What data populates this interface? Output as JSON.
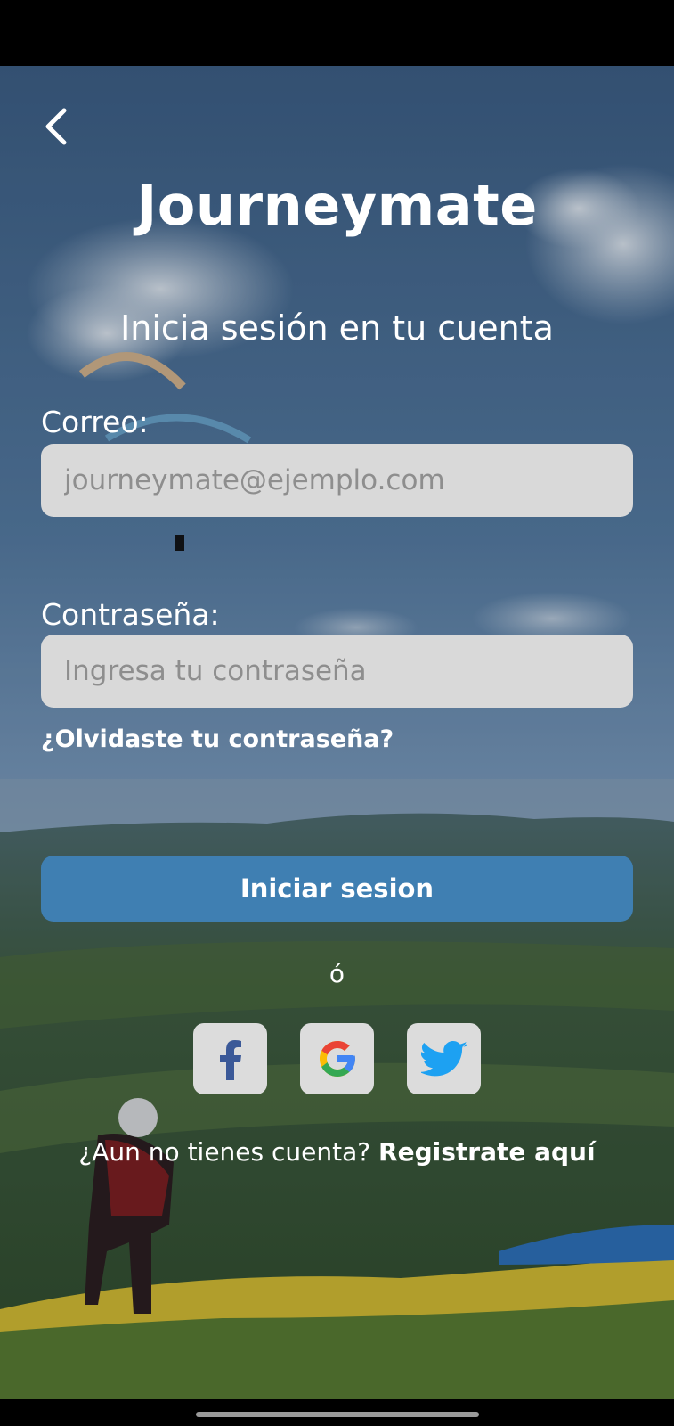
{
  "app": {
    "title": "Journeymate"
  },
  "login": {
    "subtitle": "Inicia sesión en tu cuenta",
    "email_label": "Correo:",
    "email_placeholder": "journeymate@ejemplo.com",
    "email_value": "",
    "password_label": "Contraseña:",
    "password_placeholder": "Ingresa tu contraseña",
    "password_value": "",
    "forgot_label": "¿Olvidaste tu contraseña?",
    "submit_label": "Iniciar sesion",
    "or_label": "ó"
  },
  "social": [
    {
      "name": "facebook",
      "icon": "facebook-icon",
      "color": "#3b5998"
    },
    {
      "name": "google",
      "icon": "google-icon",
      "color": "#4285f4"
    },
    {
      "name": "twitter",
      "icon": "twitter-icon",
      "color": "#1da1f2"
    }
  ],
  "register": {
    "prompt": "¿Aun no tienes cuenta?",
    "link_label": "Registrate aquí"
  },
  "colors": {
    "accent": "#3f7fb2",
    "field_bg": "#d9d9d9"
  }
}
